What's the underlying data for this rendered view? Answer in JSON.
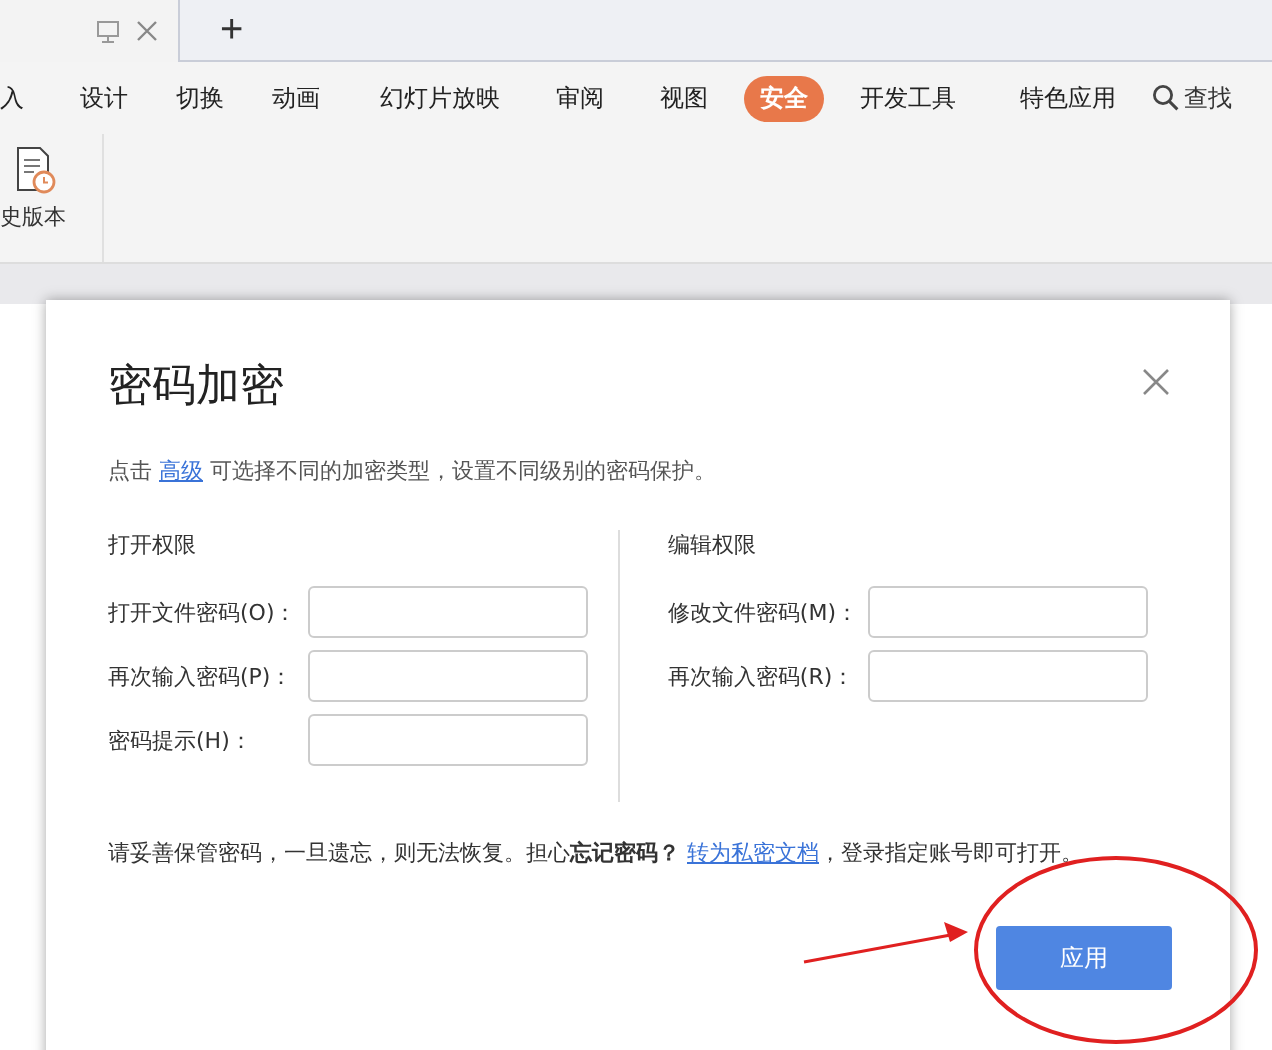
{
  "tabbar": {
    "new_tab": "+"
  },
  "menu": [
    {
      "label": "入",
      "selected": false
    },
    {
      "label": "设计",
      "selected": false
    },
    {
      "label": "切换",
      "selected": false
    },
    {
      "label": "动画",
      "selected": false
    },
    {
      "label": "幻灯片放映",
      "selected": false
    },
    {
      "label": "审阅",
      "selected": false
    },
    {
      "label": "视图",
      "selected": false
    },
    {
      "label": "安全",
      "selected": true
    },
    {
      "label": "开发工具",
      "selected": false
    },
    {
      "label": "特色应用",
      "selected": false
    }
  ],
  "search": {
    "label": "查找"
  },
  "ribbon": {
    "items": [
      {
        "label": "史版本"
      }
    ]
  },
  "dialog": {
    "title": "密码加密",
    "intro_before": "点击",
    "intro_link": "高级",
    "intro_after": "可选择不同的加密类型，设置不同级别的密码保护。",
    "open_section": {
      "title": "打开权限",
      "fields": [
        {
          "label": "打开文件密码(O)："
        },
        {
          "label": "再次输入密码(P)："
        },
        {
          "label": "密码提示(H)："
        }
      ]
    },
    "edit_section": {
      "title": "编辑权限",
      "fields": [
        {
          "label": "修改文件密码(M)："
        },
        {
          "label": "再次输入密码(R)："
        }
      ]
    },
    "note_before": "请妥善保管密码，一旦遗忘，则无法恢复。担心**忘记密码？**",
    "note_link": "转为私密文档",
    "note_after": "，登录指定账号即可打开。",
    "button": "应用"
  }
}
